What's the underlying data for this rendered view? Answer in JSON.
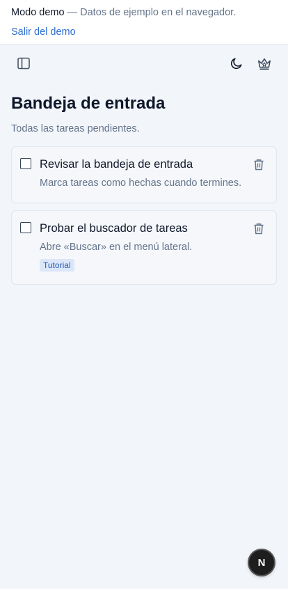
{
  "banner": {
    "mode_label": "Modo demo",
    "description": " — Datos de ejemplo en el navegador.",
    "exit_link": "Salir del demo"
  },
  "toolbar": {
    "sidebar_toggle_icon": "sidebar-panel-icon",
    "theme_icon": "moon-icon",
    "premium_icon": "crown-icon"
  },
  "page": {
    "title": "Bandeja de entrada",
    "subtitle": "Todas las tareas pendientes."
  },
  "tasks": [
    {
      "title": "Revisar la bandeja de entrada",
      "description": "Marca tareas como hechas cuando termines.",
      "checked": false
    },
    {
      "title": "Probar el buscador de tareas",
      "description": "Abre «Buscar» en el menú lateral.",
      "tag": "Tutorial",
      "checked": false
    }
  ],
  "fab": {
    "label": "N"
  },
  "colors": {
    "background": "#f2f5f9",
    "accent_link": "#2f6fd0",
    "tag_bg": "#dbe7f8",
    "tag_text": "#2b5bb0"
  }
}
